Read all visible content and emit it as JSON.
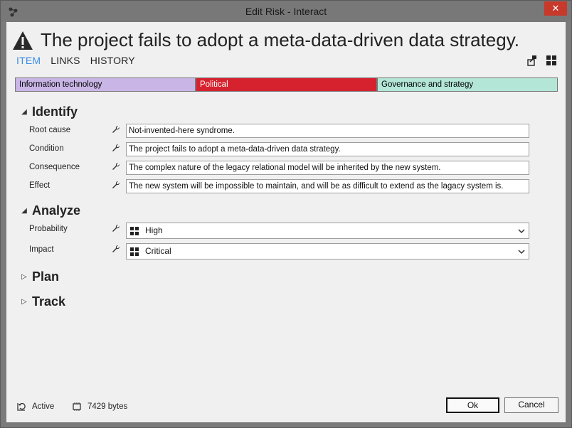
{
  "window": {
    "title": "Edit Risk - Interact",
    "close_glyph": "✕",
    "app_icon": "connections-icon"
  },
  "header": {
    "icon": "warning-icon",
    "title": "The project fails to adopt a meta-data-driven data strategy."
  },
  "tabs": [
    {
      "label": "ITEM",
      "active": true
    },
    {
      "label": "LINKS",
      "active": false
    },
    {
      "label": "HISTORY",
      "active": false
    }
  ],
  "categories": [
    {
      "label": "Information technology",
      "color": "#c9b6e6"
    },
    {
      "label": "Political",
      "color": "#d6222e"
    },
    {
      "label": "Governance and strategy",
      "color": "#b3e6d6"
    }
  ],
  "sections": {
    "identify": {
      "title": "Identify",
      "fields": [
        {
          "label": "Root cause",
          "value": "Not-invented-here syndrome."
        },
        {
          "label": "Condition",
          "value": "The project fails to adopt a meta-data-driven data strategy."
        },
        {
          "label": "Consequence",
          "value": "The complex nature of the legacy relational model will be inherited by the new system."
        },
        {
          "label": "Effect",
          "value": "The new system will be impossible to maintain, and will be as difficult to extend as the lagacy system is."
        }
      ]
    },
    "analyze": {
      "title": "Analyze",
      "fields": [
        {
          "label": "Probability",
          "value": "High"
        },
        {
          "label": "Impact",
          "value": "Critical"
        }
      ]
    },
    "plan": {
      "title": "Plan"
    },
    "track": {
      "title": "Track"
    }
  },
  "status": {
    "state": "Active",
    "size": "7429 bytes"
  },
  "buttons": {
    "ok": "Ok",
    "cancel": "Cancel"
  }
}
